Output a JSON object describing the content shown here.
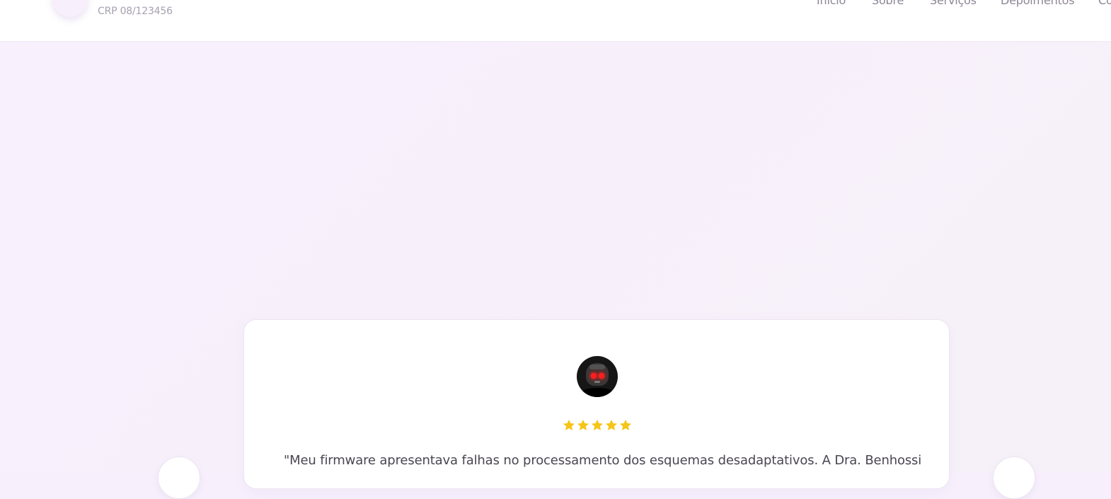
{
  "header": {
    "crp": "CRP 08/123456",
    "nav": [
      {
        "label": "Início"
      },
      {
        "label": "Sobre"
      },
      {
        "label": "Serviços"
      },
      {
        "label": "Depoimentos"
      },
      {
        "label": "Co"
      }
    ]
  },
  "testimonial": {
    "rating": 5,
    "max_rating": 5,
    "quote": "\"Meu firmware apresentava falhas no processamento dos esquemas desadaptativos. A Dra. Benhossi"
  },
  "colors": {
    "background": "#f7f0fc",
    "header": "#ffffff",
    "card": "#ffffff",
    "star": "#f5c518",
    "avatar_accent": "#cdb4ea"
  },
  "icons": {
    "logo": "user-avatar-icon",
    "star": "star-icon",
    "prev": "chevron-left-icon",
    "next": "chevron-right-icon"
  }
}
